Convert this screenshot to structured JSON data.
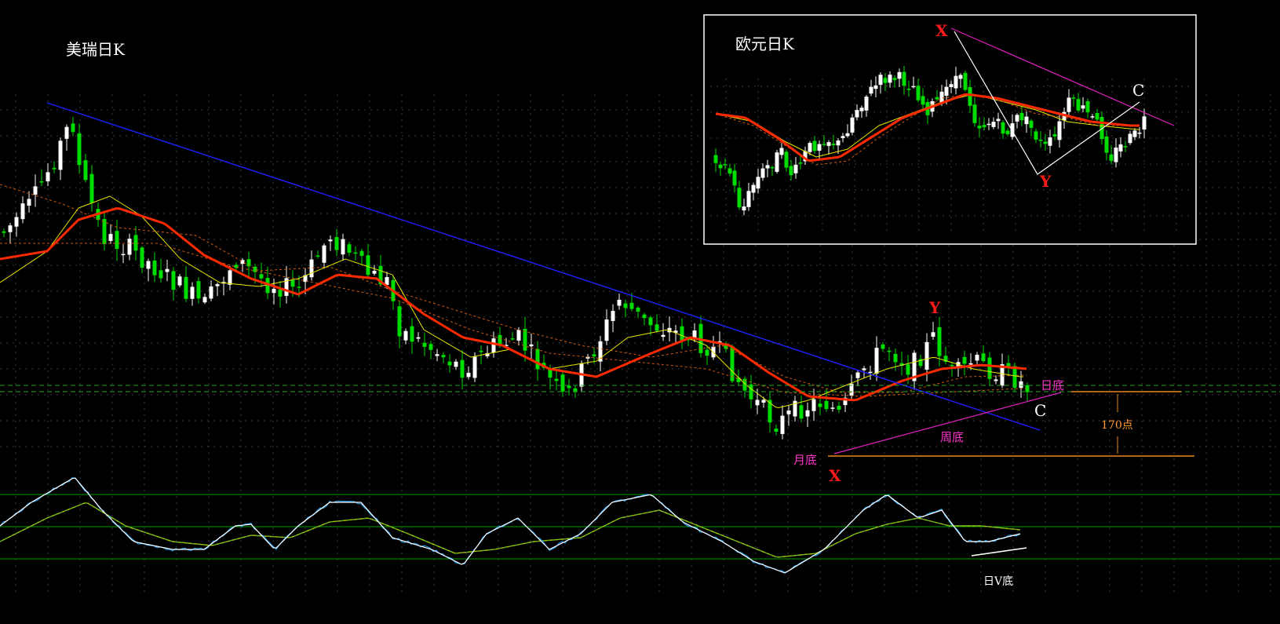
{
  "main_chart": {
    "title": "美瑞日K",
    "annotations": {
      "daily_bottom": "日底",
      "weekly_bottom": "周底",
      "monthly_bottom": "月底",
      "points": "170点",
      "point_x": "X",
      "point_y": "Y",
      "point_c": "C"
    }
  },
  "inset_chart": {
    "title": "欧元日K",
    "annotations": {
      "point_x": "X",
      "point_y": "Y",
      "point_c": "C"
    }
  },
  "oscillator": {
    "annotation": "日V底"
  },
  "colors": {
    "background": "#000000",
    "up_candle": "#ffffff",
    "down_candle": "#00dd00",
    "ma_slow": "#ff2a00",
    "ma_fast": "#e6e600",
    "ma_dotted": "#d05a10",
    "trendline": "#2020ff",
    "support_line": "#e020c0",
    "label_red": "#ff1a1a",
    "label_magenta": "#ff33cc",
    "label_orange": "#ff9933",
    "range_line": "#e08a20",
    "grid": "#3a3a3a",
    "osc_hline": "#00a000"
  },
  "chart_data": [
    {
      "type": "candlestick",
      "title": "美瑞日K",
      "annotations": [
        "日底",
        "周底",
        "月底",
        "170点",
        "X",
        "Y",
        "C"
      ],
      "indicators": [
        "moving average (red, thick)",
        "moving average (yellow)",
        "moving average (dotted orange)"
      ]
    },
    {
      "type": "candlestick",
      "title": "欧元日K",
      "annotations": [
        "X",
        "Y",
        "C"
      ]
    },
    {
      "type": "line",
      "title": "",
      "annotations": [
        "日V底"
      ]
    }
  ]
}
